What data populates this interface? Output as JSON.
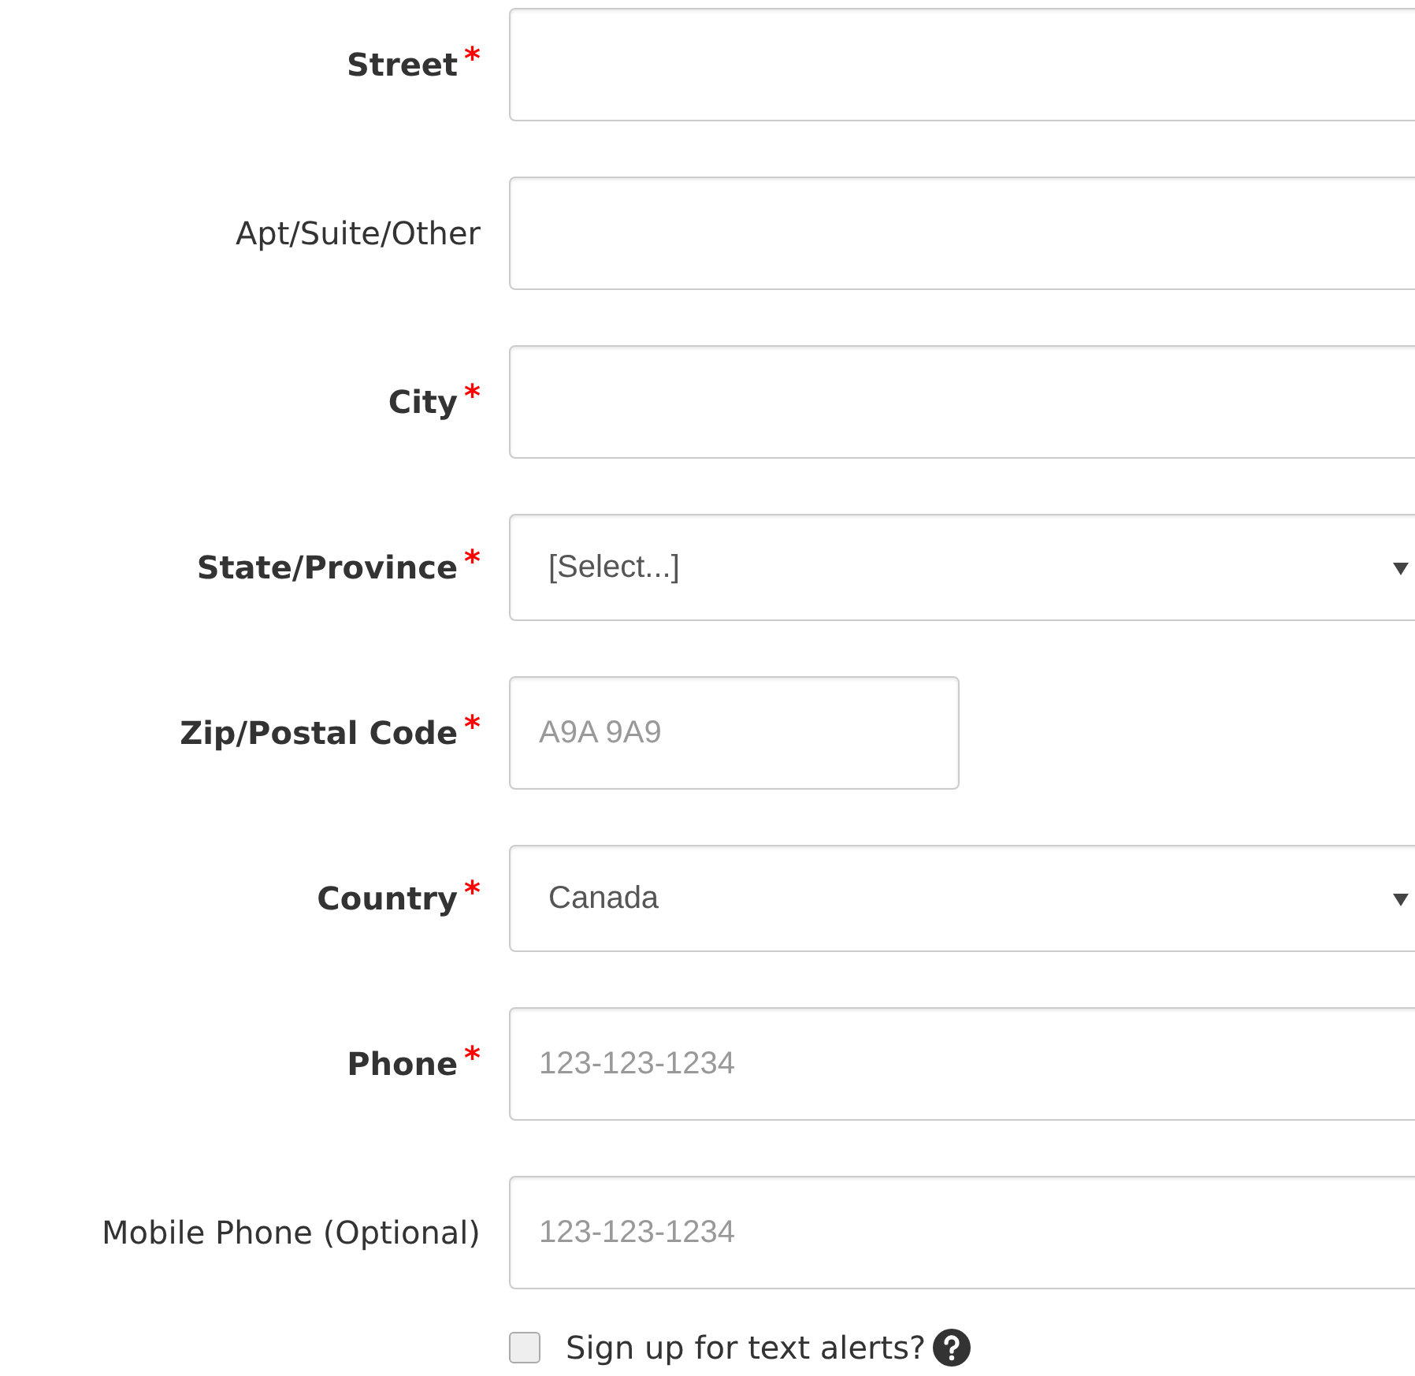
{
  "fields": [
    {
      "label": "Street",
      "required_mark": "*",
      "kind": "text"
    },
    {
      "label": "Apt/Suite/Other",
      "kind": "text"
    },
    {
      "label": "City",
      "required_mark": "*",
      "kind": "text"
    },
    {
      "label": "State/Province",
      "required_mark": "*",
      "kind": "select",
      "value": "[Select...]"
    },
    {
      "label": "Zip/Postal Code",
      "required_mark": "*",
      "kind": "short",
      "placeholder": "A9A 9A9"
    },
    {
      "label": "Country",
      "required_mark": "*",
      "kind": "select",
      "value": "Canada"
    },
    {
      "label": "Phone",
      "required_mark": "*",
      "kind": "text",
      "placeholder": "123-123-1234"
    },
    {
      "label": "Mobile Phone (Optional)",
      "kind": "text",
      "placeholder": "123-123-1234"
    }
  ],
  "text_alerts": {
    "label": "Sign up for text alerts?",
    "checked": false
  }
}
